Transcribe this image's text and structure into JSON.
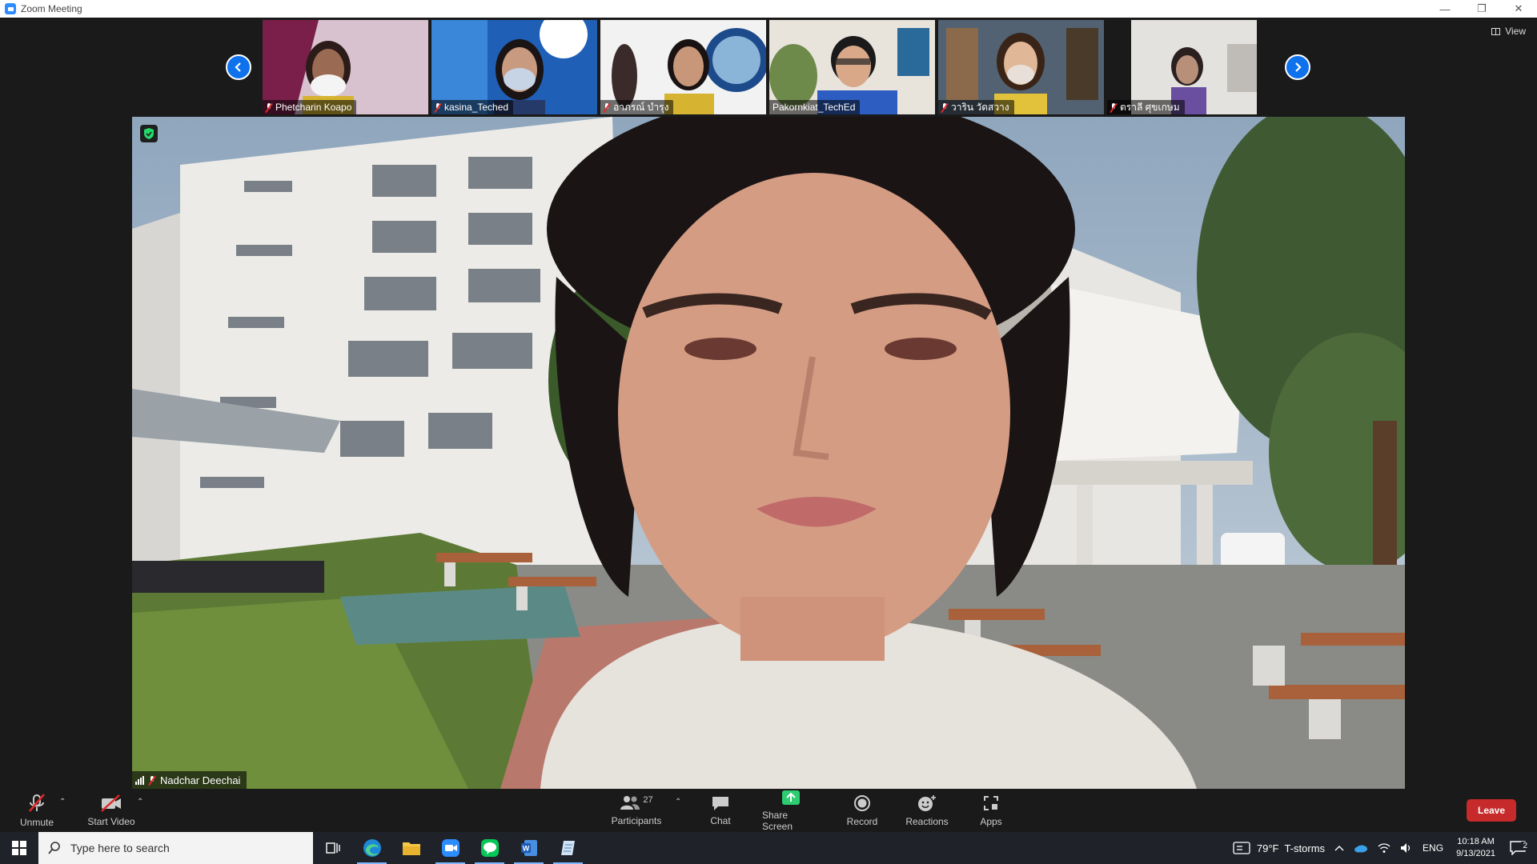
{
  "window": {
    "title": "Zoom Meeting"
  },
  "gallery": {
    "thumbnails": [
      {
        "name": "Phetcharin Koapo",
        "muted": true
      },
      {
        "name": "kasina_Teched",
        "muted": true
      },
      {
        "name": "อาภรณ์ บำรุง",
        "muted": true
      },
      {
        "name": "Pakornkiat_TechEd",
        "muted": false
      },
      {
        "name": "วาริน วัดสวาง",
        "muted": true
      },
      {
        "name": "ตราลี ศุขเกษม",
        "muted": true
      }
    ],
    "view_label": "View"
  },
  "main_video": {
    "speaker_name": "Nadchar Deechai"
  },
  "toolbar": {
    "unmute_label": "Unmute",
    "start_video_label": "Start Video",
    "participants_label": "Participants",
    "participants_count": "27",
    "chat_label": "Chat",
    "share_screen_label": "Share Screen",
    "record_label": "Record",
    "reactions_label": "Reactions",
    "apps_label": "Apps",
    "leave_label": "Leave"
  },
  "taskbar": {
    "search_placeholder": "Type here to search",
    "weather": "79°F  T-storms",
    "language": "ENG",
    "time": "10:18 AM",
    "date": "9/13/2021",
    "notification_count": "2"
  },
  "colors": {
    "accent": "#0e72ed",
    "leave": "#c62a2a",
    "share": "#2ecc71"
  }
}
